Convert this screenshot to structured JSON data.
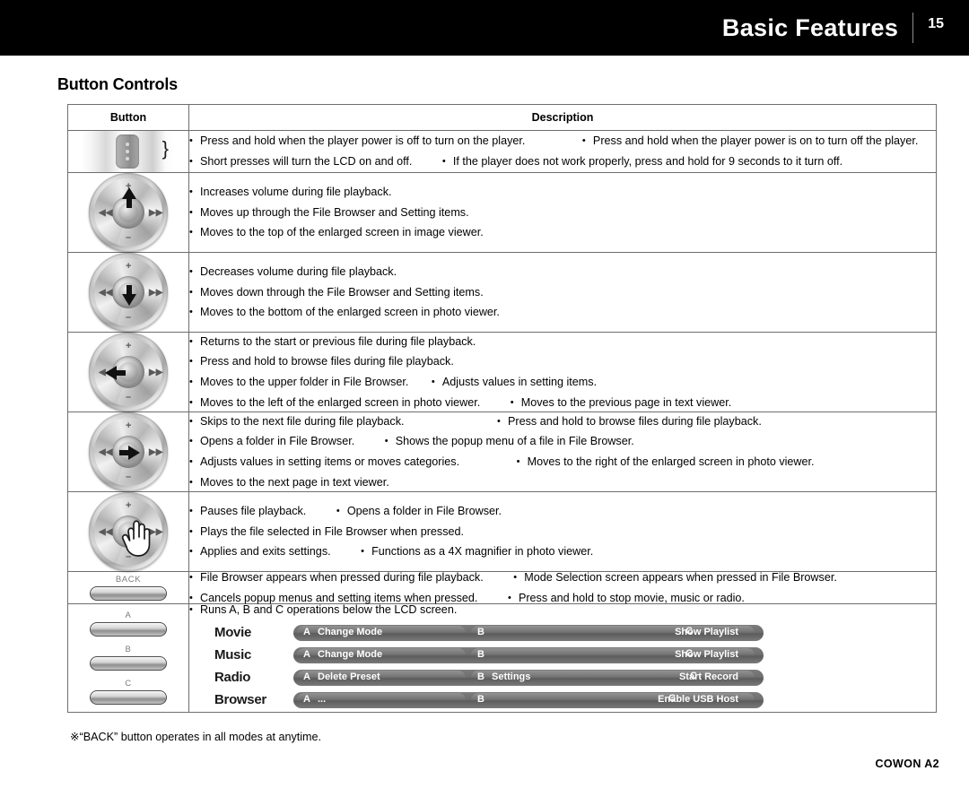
{
  "header": {
    "title": "Basic Features",
    "page_number": "15"
  },
  "section_title": "Button Controls",
  "table": {
    "headers": {
      "button": "Button",
      "description": "Description"
    },
    "rows": [
      {
        "icon": "power-slide-button",
        "lines": [
          [
            "Press and hold when the player power is off to turn on the player.",
            "Press and hold when the player power is on to turn off the player."
          ],
          [
            "Short presses will turn the LCD on and off.",
            "If the player does not work properly, press and hold for 9 seconds to it turn off."
          ]
        ]
      },
      {
        "icon": "jog-wheel-up-button",
        "lines": [
          [
            "Increases volume during file playback."
          ],
          [
            "Moves up through the File Browser and Setting items."
          ],
          [
            "Moves to the top of the enlarged screen in image viewer."
          ]
        ]
      },
      {
        "icon": "jog-wheel-down-button",
        "lines": [
          [
            "Decreases volume during file playback."
          ],
          [
            "Moves down through the File Browser and Setting items."
          ],
          [
            "Moves to the bottom of the enlarged screen in photo viewer."
          ]
        ]
      },
      {
        "icon": "jog-wheel-left-button",
        "lines": [
          [
            "Returns to the start or previous file during file playback."
          ],
          [
            "Press and hold to browse files during file playback."
          ],
          [
            "Moves to the upper folder in File Browser.",
            "Adjusts values in setting items."
          ],
          [
            "Moves to the left of the enlarged screen in photo viewer.",
            "Moves to the previous page in text viewer."
          ]
        ]
      },
      {
        "icon": "jog-wheel-right-button",
        "lines": [
          [
            "Skips to the next file during file playback.",
            "Press and hold to browse files during file playback."
          ],
          [
            "Opens a folder in File Browser.",
            "Shows the popup menu of a file in File Browser."
          ],
          [
            "Adjusts values in setting items or moves categories.",
            "Moves to the right of the enlarged screen in photo viewer."
          ],
          [
            "Moves to the next page in text viewer."
          ]
        ]
      },
      {
        "icon": "jog-wheel-press-button",
        "lines": [
          [
            "Pauses file playback.",
            "Opens a folder in File Browser."
          ],
          [
            "Plays the file selected in File Browser when pressed."
          ],
          [
            "Applies and exits settings.",
            "Functions as a 4X magnifier in photo viewer."
          ]
        ]
      },
      {
        "icon": "back-button",
        "icon_label": "BACK",
        "lines": [
          [
            "File Browser appears when pressed during file playback.",
            "Mode Selection screen appears when pressed in File Browser."
          ],
          [
            "Cancels popup menus and setting items when pressed.",
            "Press and hold to stop movie, music or radio."
          ]
        ]
      },
      {
        "icon": "abc-buttons",
        "icon_labels": [
          "A",
          "B",
          "C"
        ],
        "lines": [
          [
            "Runs A, B and C operations below the LCD screen."
          ]
        ]
      }
    ]
  },
  "lcd_modes": [
    {
      "mode": "Movie",
      "a_key": "A",
      "a_text": "Change Mode",
      "b_key": "B",
      "b_text": "",
      "c_key": "C",
      "c_text": "Show Playlist"
    },
    {
      "mode": "Music",
      "a_key": "A",
      "a_text": "Change Mode",
      "b_key": "B",
      "b_text": "",
      "c_key": "C",
      "c_text": "Show Playlist"
    },
    {
      "mode": "Radio",
      "a_key": "A",
      "a_text": "Delete Preset",
      "b_key": "B",
      "b_text": "Settings",
      "c_key": "C",
      "c_text": "Start Record"
    },
    {
      "mode": "Browser",
      "a_key": "A",
      "a_text": "...",
      "b_key": "B",
      "b_text": "",
      "c_key": "C",
      "c_text": "Enable USB Host"
    }
  ],
  "footnote": "※“BACK” button operates in all modes at anytime.",
  "footer_brand": "COWON A2"
}
